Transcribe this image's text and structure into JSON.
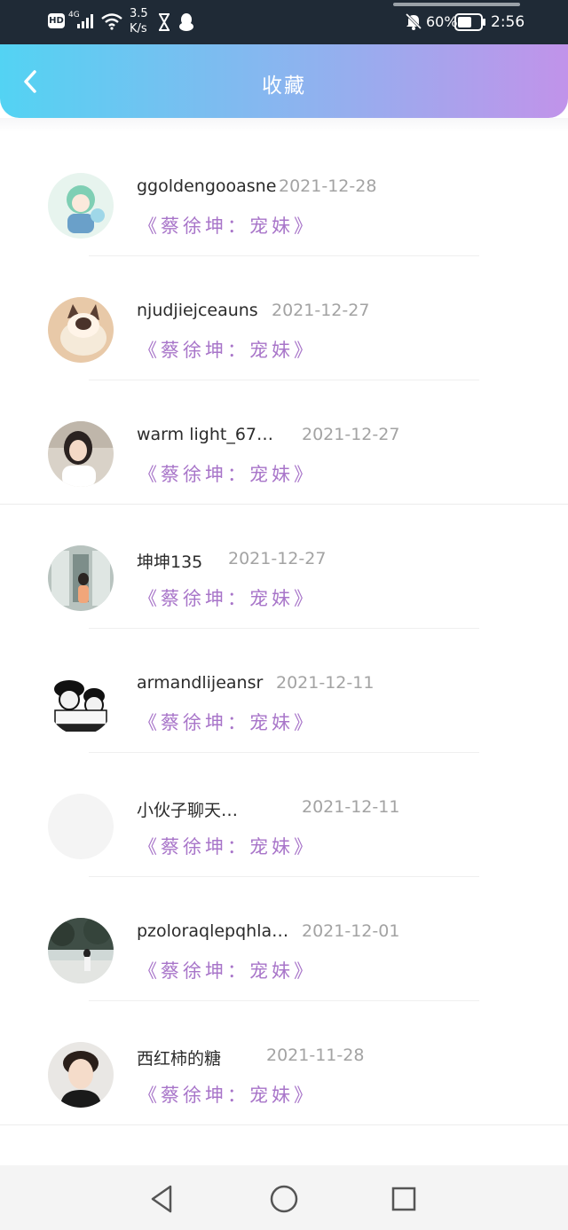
{
  "status_bar": {
    "network": "4G",
    "hd": "HD",
    "speed_value": "3.5",
    "speed_unit": "K/s",
    "battery": "60%",
    "time": "2:56"
  },
  "header": {
    "title": "收藏",
    "back_icon": "chevron-left-icon"
  },
  "items": [
    {
      "username": "ggoldengooasne",
      "date": "2021-12-28",
      "title": "《蔡徐坤：宠妹》"
    },
    {
      "username": "njudjiejceauns",
      "date": "2021-12-27",
      "title": "《蔡徐坤：宠妹》"
    },
    {
      "username": "warm light_67…",
      "date": "2021-12-27",
      "title": "《蔡徐坤：宠妹》"
    },
    {
      "username": "坤坤135",
      "date": "2021-12-27",
      "title": "《蔡徐坤：宠妹》"
    },
    {
      "username": "armandlijeansr",
      "date": "2021-12-11",
      "title": "《蔡徐坤：宠妹》"
    },
    {
      "username": "小伙子聊天…",
      "date": "2021-12-11",
      "title": "《蔡徐坤：宠妹》"
    },
    {
      "username": "pzoloraqlepqhla…",
      "date": "2021-12-01",
      "title": "《蔡徐坤：宠妹》"
    },
    {
      "username": "西红柿的糖",
      "date": "2021-11-28",
      "title": "《蔡徐坤：宠妹》"
    }
  ],
  "nav": {
    "back": "triangle-back-icon",
    "home": "circle-home-icon",
    "recents": "square-recents-icon"
  },
  "colors": {
    "header_gradient_start": "#53d3f3",
    "header_gradient_end": "#c193ea",
    "title_purple": "#a875c9",
    "date_gray": "#a3a3a3"
  }
}
